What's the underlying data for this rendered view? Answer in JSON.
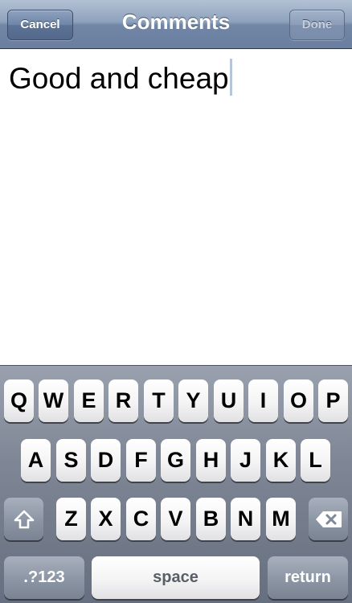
{
  "navbar": {
    "title": "Comments",
    "cancel_label": "Cancel",
    "done_label": "Done"
  },
  "editor": {
    "text": "Good and cheap"
  },
  "keyboard": {
    "row1": [
      "Q",
      "W",
      "E",
      "R",
      "T",
      "Y",
      "U",
      "I",
      "O",
      "P"
    ],
    "row2": [
      "A",
      "S",
      "D",
      "F",
      "G",
      "H",
      "J",
      "K",
      "L"
    ],
    "row3": [
      "Z",
      "X",
      "C",
      "V",
      "B",
      "N",
      "M"
    ],
    "shift_icon": "shift-arrow-icon",
    "backspace_icon": "backspace-icon",
    "numbers_label": ".?123",
    "space_label": "space",
    "return_label": "return"
  }
}
